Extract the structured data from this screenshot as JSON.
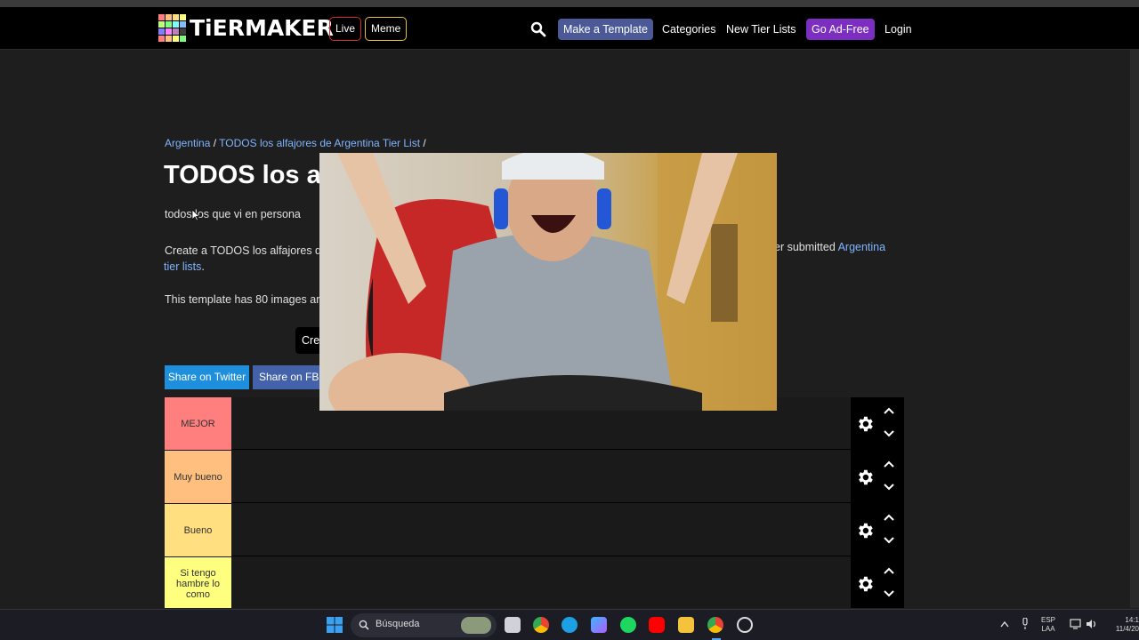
{
  "nav": {
    "logo_text": "TiERMAKER",
    "live_label": "Live",
    "meme_label": "Meme",
    "make_template_label": "Make a Template",
    "categories_label": "Categories",
    "new_tier_lists_label": "New Tier Lists",
    "ad_free_label": "Go Ad-Free",
    "login_label": "Login",
    "logo_colors": [
      "#ff7f7f",
      "#ffbf7f",
      "#ffdf7f",
      "#ffff7f",
      "#bfff7f",
      "#7fff7f",
      "#7fffff",
      "#7fbfff",
      "#7f7fff",
      "#ff7fff",
      "#bf7fbf",
      "#3f3f3f",
      "#ff7f7f",
      "#ffbf7f",
      "#ffff7f",
      "#7fff7f"
    ]
  },
  "breadcrumb": {
    "link1": "Argentina",
    "sep1": " / ",
    "link2": "TODOS los alfajores de Argentina Tier List",
    "sep2": " /"
  },
  "page": {
    "title": "TODOS los a",
    "subtitle": "todos los que vi en persona",
    "desc_start": "Create a TODOS los alfajores d",
    "desc_right": "er submitted ",
    "desc_link": "Argentina",
    "desc_link2": "tier lists",
    "desc_end": ".",
    "image_count_text": "This template has 80 images ar",
    "create_label": "Cre",
    "share_twitter": "Share on Twitter",
    "share_fb": "Share on FB"
  },
  "tiers": [
    {
      "label": "MEJOR",
      "color": "#ff7f7f"
    },
    {
      "label": "Muy bueno",
      "color": "#ffbf7f"
    },
    {
      "label": "Bueno",
      "color": "#ffdf7f"
    },
    {
      "label": "Si tengo hambre lo como",
      "color": "#ffff7f"
    }
  ],
  "taskbar": {
    "search_label": "Búsqueda",
    "lang_line1": "ESP",
    "lang_line2": "LAA",
    "time": "14:1",
    "date": "11/4/20"
  }
}
